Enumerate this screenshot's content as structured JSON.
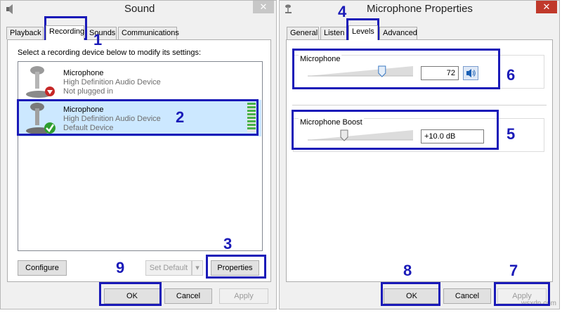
{
  "sound": {
    "title": "Sound",
    "close_glyph": "✕",
    "tabs": [
      "Playback",
      "Recording",
      "Sounds",
      "Communications"
    ],
    "instruction": "Select a recording device below to modify its settings:",
    "devices": [
      {
        "name": "Microphone",
        "desc": "High Definition Audio Device",
        "status": "Not plugged in",
        "status_icon": "red-down-arrow-icon"
      },
      {
        "name": "Microphone",
        "desc": "High Definition Audio Device",
        "status": "Default Device",
        "status_icon": "green-check-icon"
      }
    ],
    "configure_label": "Configure",
    "set_default_label": "Set Default",
    "properties_label": "Properties",
    "ok_label": "OK",
    "cancel_label": "Cancel",
    "apply_label": "Apply"
  },
  "mic": {
    "title": "Microphone Properties",
    "close_glyph": "✕",
    "tabs": [
      "General",
      "Listen",
      "Levels",
      "Advanced"
    ],
    "microphone_label": "Microphone",
    "microphone_level": 72,
    "microphone_value": "72",
    "boost_label": "Microphone Boost",
    "boost_value": "+10.0 dB",
    "ok_label": "OK",
    "cancel_label": "Cancel",
    "apply_label": "Apply"
  },
  "annotations": [
    "1",
    "2",
    "3",
    "4",
    "5",
    "6",
    "7",
    "8",
    "9"
  ],
  "watermark": "wsxdn.com",
  "colors": {
    "annotation": "#1a1ab8",
    "selection": "#cce8ff",
    "meter": "#48b14a",
    "close_active": "#c0392b"
  }
}
